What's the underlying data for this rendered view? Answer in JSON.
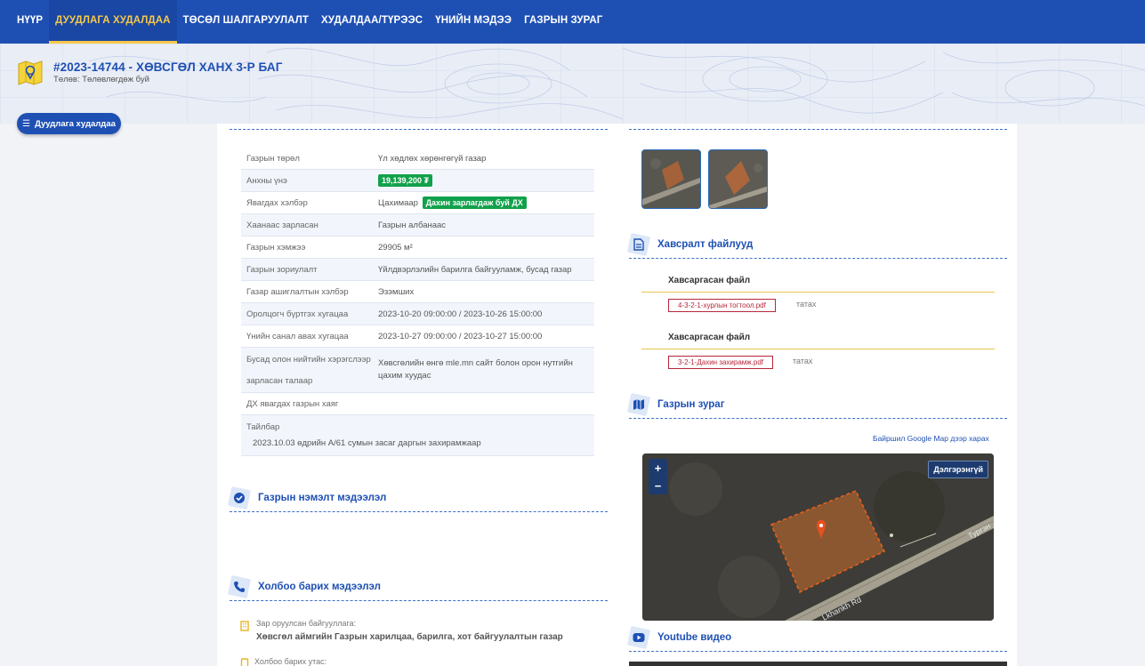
{
  "nav": {
    "items": [
      {
        "label": "НҮҮР"
      },
      {
        "label": "ДУУДЛАГА ХУДАЛДАА"
      },
      {
        "label": "ТӨСӨЛ ШАЛГАРУУЛАЛТ"
      },
      {
        "label": "ХУДАЛДАА/ТҮРЭЭС"
      },
      {
        "label": "ҮНИЙН МЭДЭЭ"
      },
      {
        "label": "ГАЗРЫН ЗУРАГ"
      }
    ]
  },
  "header": {
    "title": "#2023-14744 - ХӨВСГӨЛ ХАНХ 3-Р БАГ",
    "subtitle": "Төлөв: Төлөвлөгдөж буй"
  },
  "side_button": {
    "label": "Дуудлага худалдаа"
  },
  "info": [
    {
      "k": "Газрын төрөл",
      "v": "Үл хөдлөх хөрөнгөгүй газар"
    },
    {
      "k": "Анхны үнэ",
      "badge": "19,139,200 ₮"
    },
    {
      "k": "Явагдах хэлбэр",
      "v": "Цахимаар",
      "badge": "Дахин зарлагдаж буй ДХ"
    },
    {
      "k": "Хаанаас зарласан",
      "v": "Газрын албанаас"
    },
    {
      "k": "Газрын хэмжээ",
      "v": "29905 м²"
    },
    {
      "k": "Газрын зориулалт",
      "v": "Үйлдвэрлэлийн барилга байгууламж, бусад газар"
    },
    {
      "k": "Газар ашиглалтын хэлбэр",
      "v": "Эзэмших"
    },
    {
      "k": "Оролцогч бүртгэх хугацаа",
      "v": "2023-10-20 09:00:00 / 2023-10-26 15:00:00"
    },
    {
      "k": "Үнийн санал авах хугацаа",
      "v": "2023-10-27 09:00:00 / 2023-10-27 15:00:00"
    },
    {
      "k": "Бусад олон нийтийн хэрэгслээр зарласан талаар",
      "v": "Хөвсгөлийн өнгө mle.mn сайт болон орон нутгийн цахим хуудас"
    },
    {
      "k": "ДХ явагдах газрын хаяг",
      "v": ""
    }
  ],
  "note": {
    "label": "Тайлбар",
    "text": "2023.10.03 өдрийн А/61 сумын засаг даргын захирамжаар"
  },
  "sections": {
    "extra": "Газрын нэмэлт мэдээлэл",
    "contact": "Холбоо барих мэдээлэл",
    "files": "Хавсралт файлууд",
    "map": "Газрын зураг",
    "youtube": "Youtube видео"
  },
  "contact": {
    "org_label": "Зар оруулсан байгууллага:",
    "org_value": "Хөвсгөл аймгийн Газрын харилцаа, барилга, хот байгуулалтын газар",
    "phone_label": "Холбоо барих утас:"
  },
  "files": [
    {
      "header": "Хавсаргасан файл",
      "name": "4-3-2-1-хурлын тогтоол.pdf",
      "download": "татах"
    },
    {
      "header": "Хавсаргасан файл",
      "name": "3-2-1-Дахин захирамж.pdf",
      "download": "татах"
    }
  ],
  "map": {
    "google_link": "Байршил Google Map дээр харах",
    "more": "Дэлгэрэнгүй",
    "zoom_in": "+",
    "zoom_out": "−",
    "road_label_1": "Тургэн",
    "road_label_2": "Lkhankh Rd"
  },
  "colors": {
    "brand": "#1e50b4",
    "accent": "#f7c948",
    "badge": "#12a14b"
  }
}
